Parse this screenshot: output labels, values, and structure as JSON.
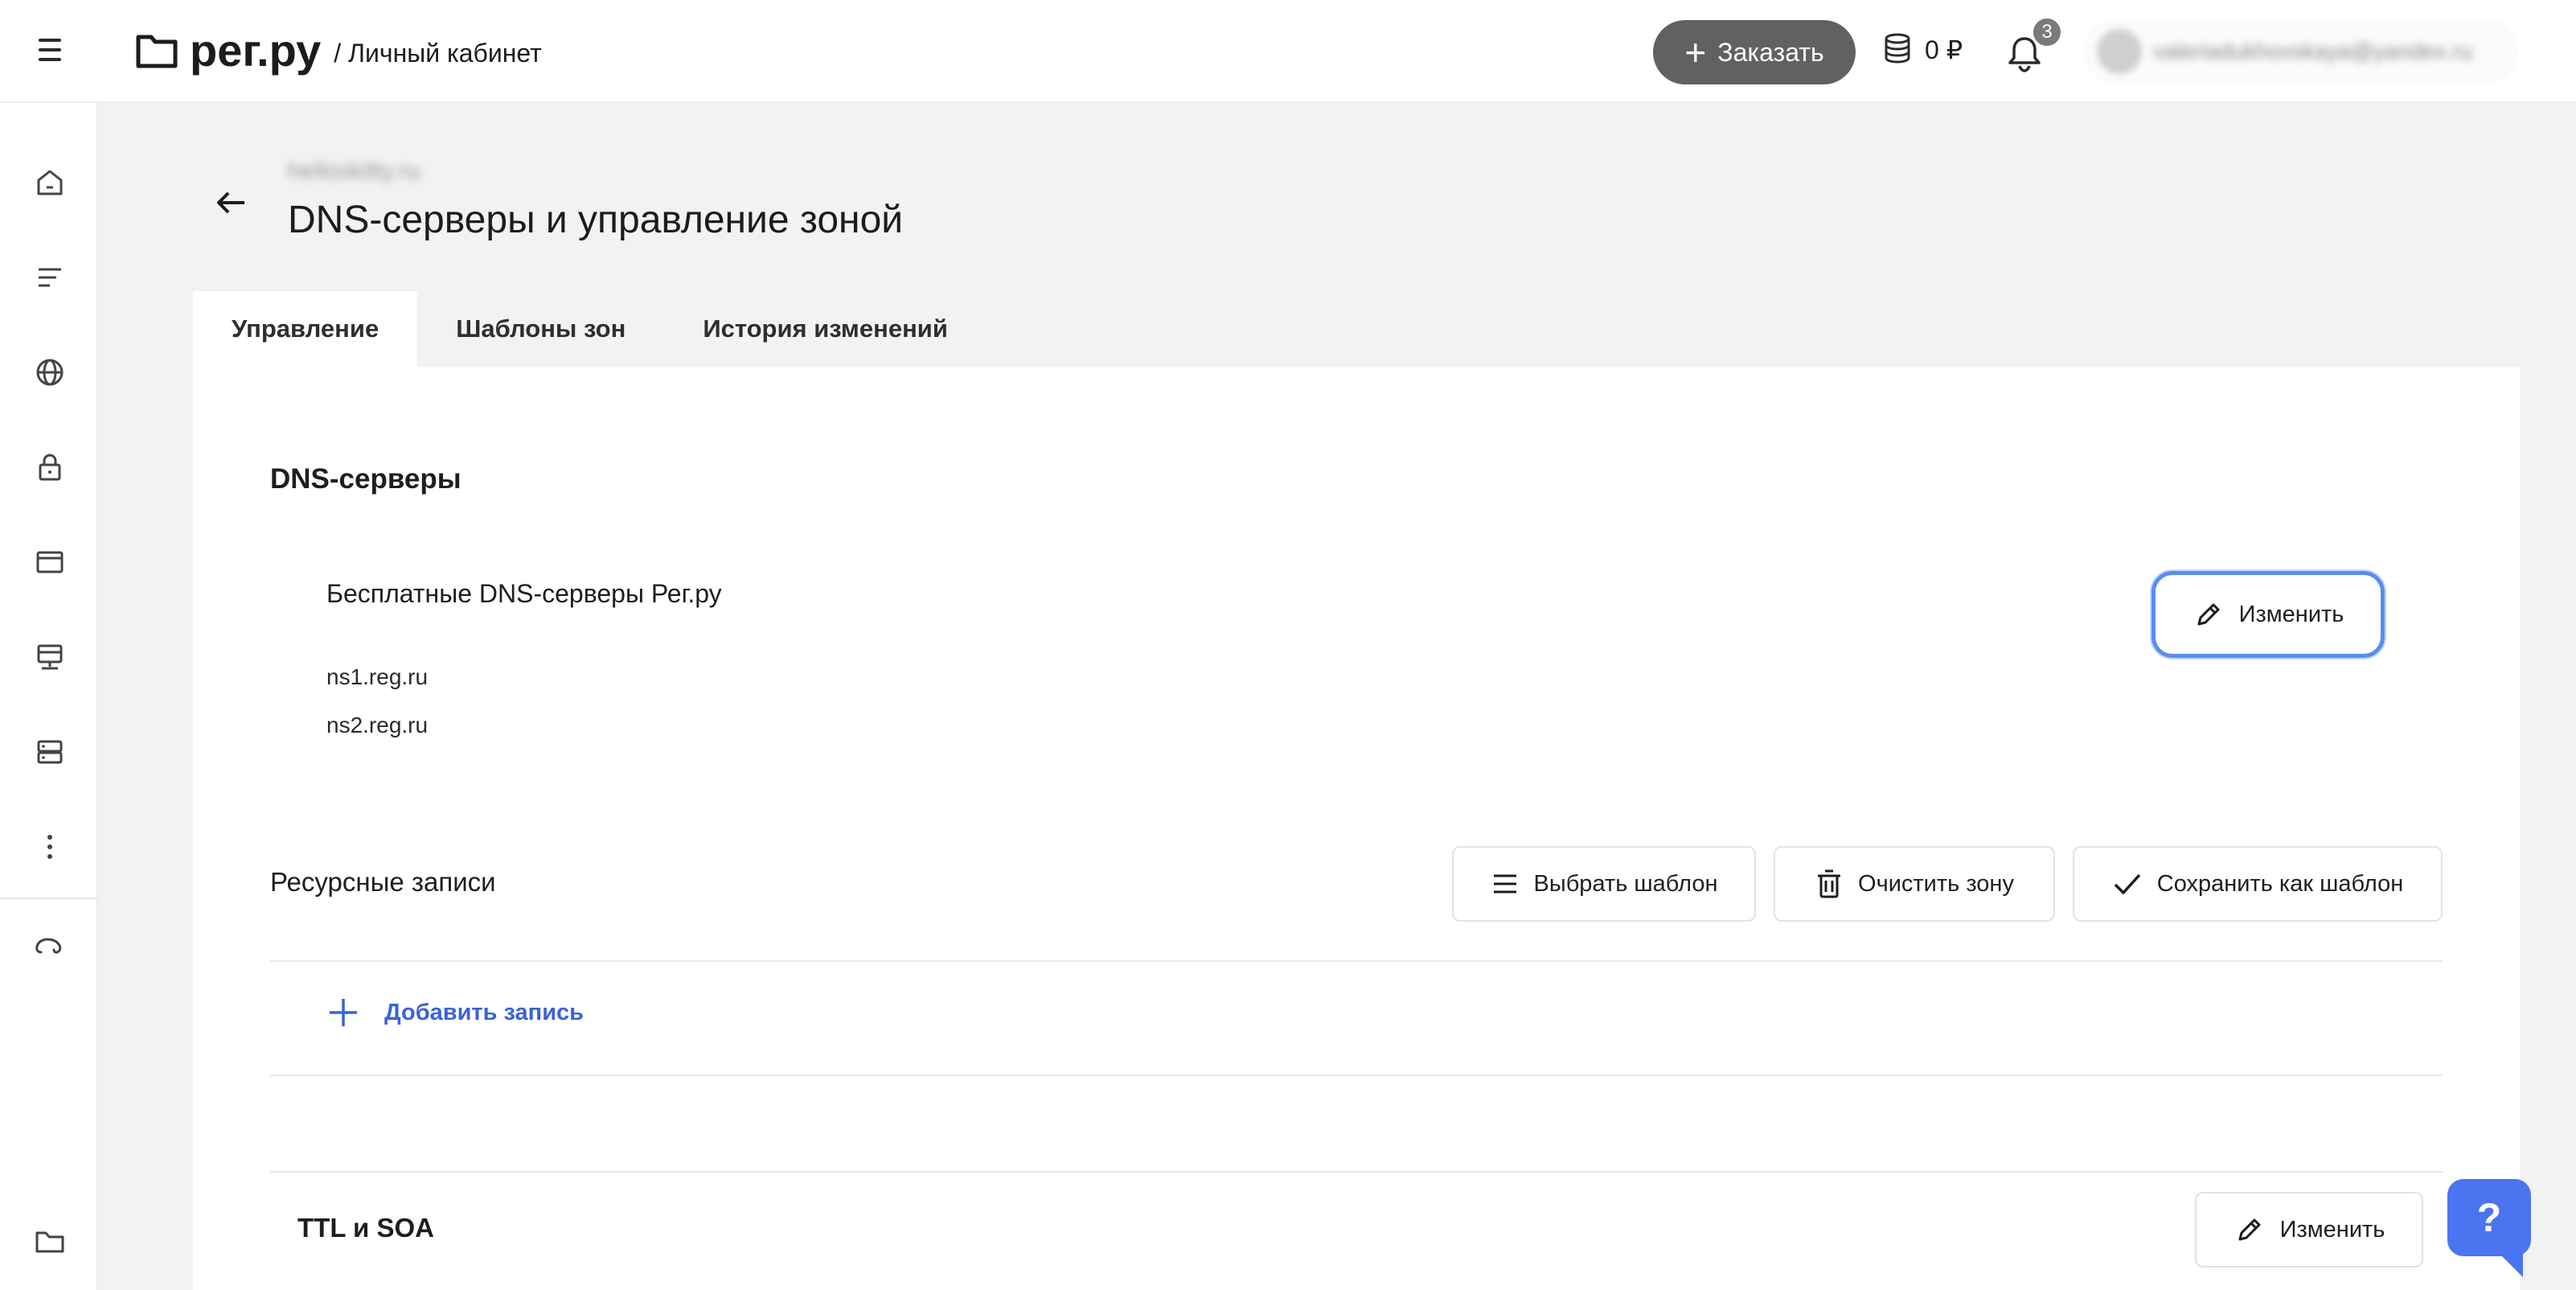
{
  "header": {
    "logo_text": "рег.ру",
    "logo_sub": "/ Личный кабинет",
    "order_label": "Заказать",
    "order_icon": "plus-icon",
    "balance": "0 ₽",
    "notifications_count": "3",
    "user_email": "valeriadukhovskaya@yandex.ru"
  },
  "sidebar": {
    "icons": [
      "home-icon",
      "list-icon",
      "globe-icon",
      "lock-icon",
      "browser-window-icon",
      "hosting-icon",
      "server-icon",
      "more-dots-icon",
      "cloud-icon",
      "folder-icon"
    ]
  },
  "page": {
    "breadcrumb": "helloskitty.ru",
    "title": "DNS-серверы и управление зоной"
  },
  "tabs": [
    {
      "label": "Управление",
      "active": true
    },
    {
      "label": "Шаблоны зон",
      "active": false
    },
    {
      "label": "История изменений",
      "active": false
    }
  ],
  "dns": {
    "heading": "DNS-серверы",
    "provider": "Бесплатные DNS-серверы Рег.ру",
    "servers": [
      "ns1.reg.ru",
      "ns2.reg.ru"
    ],
    "edit_label": "Изменить"
  },
  "records": {
    "heading": "Ресурсные записи",
    "choose_template": "Выбрать шаблон",
    "clear_zone": "Очистить зону",
    "save_template": "Сохранить как шаблон",
    "add_record": "Добавить запись"
  },
  "ttl": {
    "heading": "TTL и SOA",
    "edit_label": "Изменить"
  },
  "help": {
    "label": "?"
  },
  "colors": {
    "accent": "#4a74f0",
    "link": "#3a63d9",
    "focus_ring": "#5b8def",
    "order_button": "#616161"
  }
}
